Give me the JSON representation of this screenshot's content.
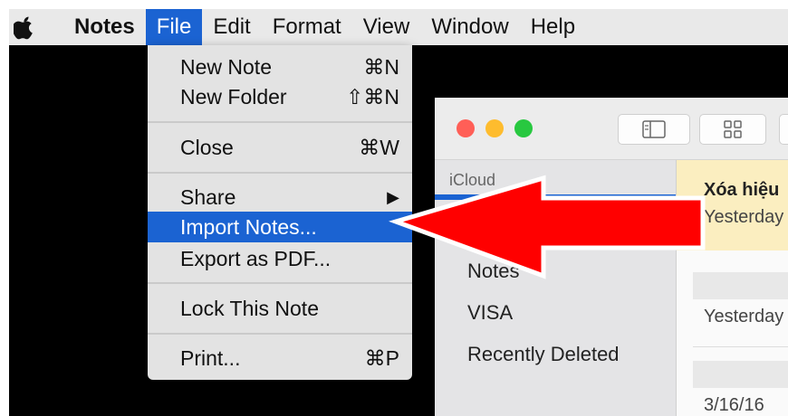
{
  "menubar": {
    "app_name": "Notes",
    "items": [
      "File",
      "Edit",
      "Format",
      "View",
      "Window",
      "Help"
    ]
  },
  "file_menu": {
    "groups": [
      [
        {
          "label": "New Note",
          "shortcut": "⌘N"
        },
        {
          "label": "New Folder",
          "shortcut": "⇧⌘N"
        }
      ],
      [
        {
          "label": "Close",
          "shortcut": "⌘W"
        }
      ],
      [
        {
          "label": "Share",
          "shortcut": "▶"
        },
        {
          "label": "Import Notes...",
          "shortcut": "",
          "highlighted": true
        },
        {
          "label": "Export as PDF...",
          "shortcut": ""
        }
      ],
      [
        {
          "label": "Lock This Note",
          "shortcut": ""
        }
      ],
      [
        {
          "label": "Print...",
          "shortcut": "⌘P"
        }
      ]
    ]
  },
  "sidebar": {
    "header": "iCloud",
    "items": [
      "Notes",
      "VISA",
      "Recently Deleted"
    ]
  },
  "note_list": {
    "selected_title": "Xóa hiệu",
    "selected_date": "Yesterday",
    "items": [
      {
        "date": "Yesterday"
      },
      {
        "date": "3/16/16"
      }
    ]
  },
  "colors": {
    "menu_highlight": "#1b63d2",
    "arrow": "#ff0000",
    "note_selected_bg": "#fbeec0"
  },
  "icons": [
    "apple-logo-icon",
    "sidebar-toggle-icon",
    "gallery-grid-icon",
    "red-arrow-icon"
  ]
}
